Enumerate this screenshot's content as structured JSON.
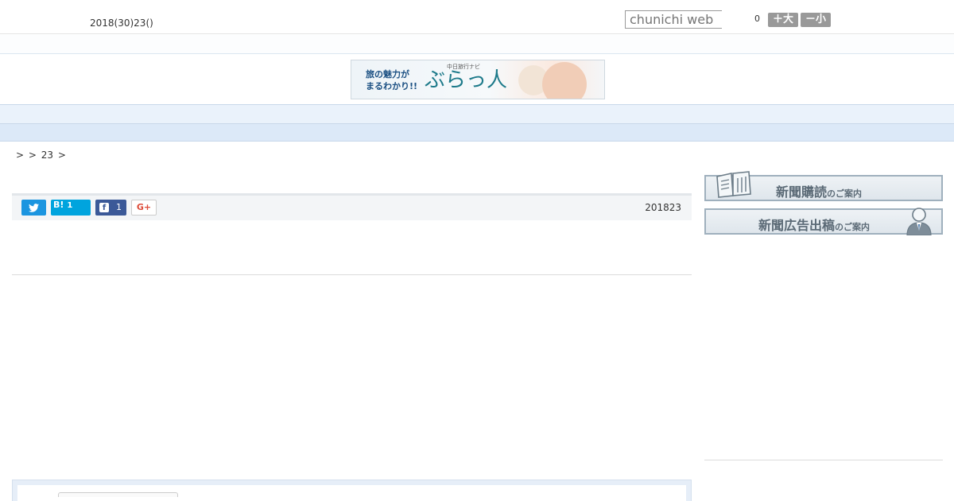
{
  "header": {
    "date": "2018(30)23()",
    "search_placeholder": "chunichi web",
    "counter": "0",
    "size_up_label": "＋大",
    "size_down_label": "－小"
  },
  "banner": {
    "left_line1": "旅の魅力が",
    "left_line2": "まるわかり!!",
    "small_text": "中日旅行ナビ",
    "brand": "ぶらっ人"
  },
  "nav": {
    "items": [
      "",
      "",
      "",
      "",
      "",
      "",
      "",
      "",
      ""
    ]
  },
  "breadcrumb": ">  > 23 >",
  "share": {
    "hatena_label": "B!",
    "hatena_count": "1",
    "facebook_count": "1",
    "gplus_label": "G+",
    "date": "201823"
  },
  "sidebar": {
    "subscribe_main": "新聞購読",
    "subscribe_suffix": "のご案内",
    "ad_main": "新聞広告出稿",
    "ad_suffix": "のご案内"
  },
  "colors": {
    "nav_bg": "#eaf2fb",
    "twitter": "#1b95e0",
    "hatena": "#00a4de",
    "facebook": "#3b5998"
  }
}
